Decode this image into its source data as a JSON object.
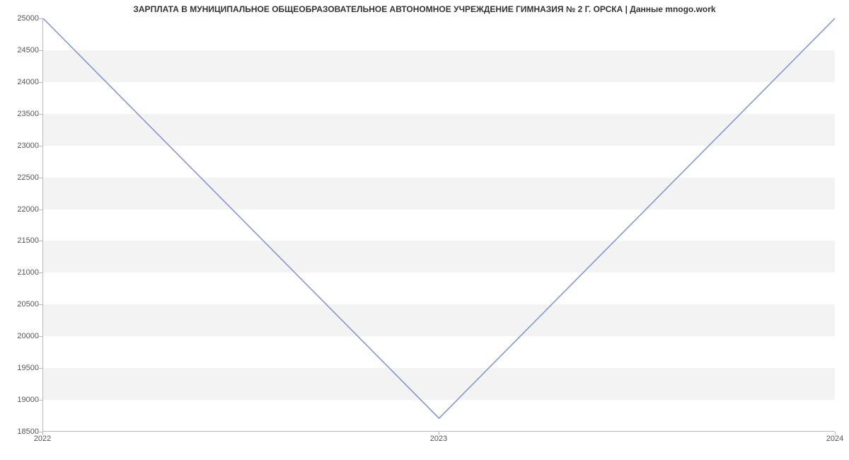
{
  "chart_data": {
    "type": "line",
    "title": "ЗАРПЛАТА В МУНИЦИПАЛЬНОЕ ОБЩЕОБРАЗОВАТЕЛЬНОЕ АВТОНОМНОЕ УЧРЕЖДЕНИЕ ГИМНАЗИЯ № 2 Г. ОРСКА | Данные mnogo.work",
    "x": [
      2022,
      2023,
      2024
    ],
    "values": [
      25000,
      18700,
      25000
    ],
    "xlabel": "",
    "ylabel": "",
    "ylim": [
      18500,
      25000
    ],
    "xlim": [
      2022,
      2024
    ],
    "y_ticks": [
      18500,
      19000,
      19500,
      20000,
      20500,
      21000,
      21500,
      22000,
      22500,
      23000,
      23500,
      24000,
      24500,
      25000
    ],
    "x_ticks": [
      2022,
      2023,
      2024
    ],
    "line_color": "#7c91d8"
  }
}
